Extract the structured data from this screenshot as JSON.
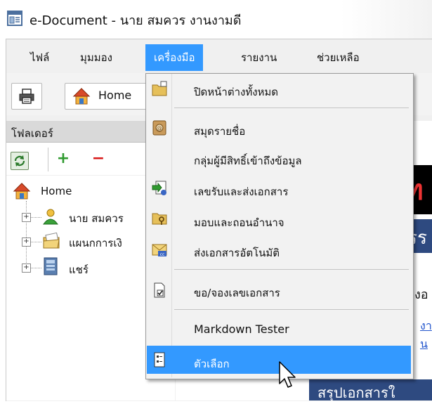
{
  "window": {
    "title": "e-Document - นาย สมควร งานงามดี"
  },
  "menubar": {
    "items": [
      {
        "label": "ไฟล์"
      },
      {
        "label": "มุมมอง"
      },
      {
        "label": "เครื่องมือ"
      },
      {
        "label": "รายงาน"
      },
      {
        "label": "ช่วยเหลือ"
      }
    ],
    "active_index": 2
  },
  "toolbar": {
    "home_label": "Home"
  },
  "folder_panel": {
    "title": "โฟลเดอร์",
    "tree": {
      "root": "Home",
      "children": [
        {
          "label": "นาย สมควร"
        },
        {
          "label": "แผนกการเงิ"
        },
        {
          "label": "แชร์"
        }
      ]
    }
  },
  "tools_menu": {
    "items": [
      {
        "label": "ปิดหน้าต่างทั้งหมด",
        "icon": "folder-close-icon"
      },
      {
        "label": "สมุดรายชื่อ",
        "icon": "address-book-icon"
      },
      {
        "label": "กลุ่มผู้มีสิทธิ์เข้าถึงข้อมูล",
        "icon": ""
      },
      {
        "label": "เลขรับและส่งเอกสาร",
        "icon": "document-exchange-icon"
      },
      {
        "label": "มอบและถอนอำนาจ",
        "icon": "folder-key-icon"
      },
      {
        "label": "ส่งเอกสารอัตโนมัติ",
        "icon": "auto-mail-icon"
      },
      {
        "label": "ขอ/จองเลขเอกสาร",
        "icon": "document-check-icon"
      },
      {
        "label": "Markdown Tester",
        "icon": ""
      },
      {
        "label": "ตัวเลือก",
        "icon": "options-icon"
      }
    ],
    "highlighted_index": 8
  },
  "background_content": {
    "banner_fragment": "ฑ",
    "header_fragment": "รร",
    "text_fragment": "งอ",
    "link1": "งา",
    "link2": "น",
    "bottom_bar": "สรุปเอกสารใ"
  },
  "colors": {
    "menu_highlight": "#3399ff",
    "panel_header": "#d9d9d9",
    "dark_blue_bar": "#2e4a80"
  }
}
